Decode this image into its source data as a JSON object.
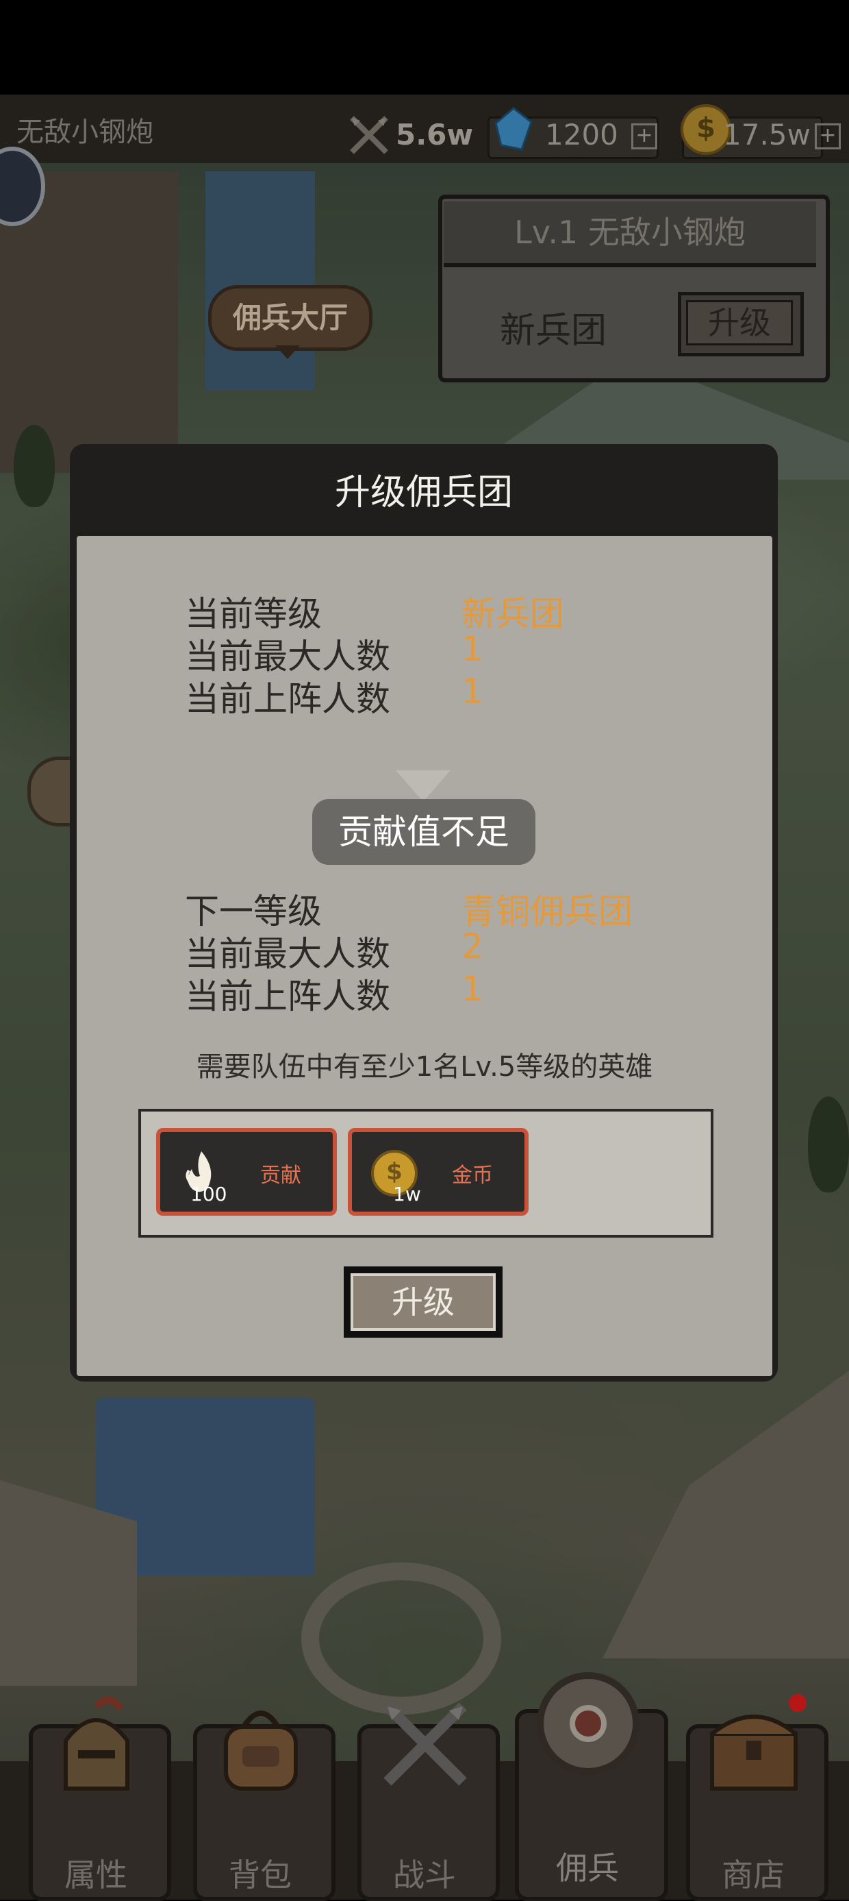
{
  "topbar": {
    "player_name": "无敌小钢炮",
    "power": "5.6w",
    "gems": "1200",
    "gold": "17.5w",
    "plus": "+"
  },
  "map": {
    "hall_label": "佣兵大厅"
  },
  "info_panel": {
    "level_title": "Lv.1 无敌小钢炮",
    "rank": "新兵团",
    "upgrade_label": "升级"
  },
  "dialog": {
    "title": "升级佣兵团",
    "current": [
      {
        "label": "当前等级",
        "value": "新兵团"
      },
      {
        "label": "当前最大人数",
        "value": "1"
      },
      {
        "label": "当前上阵人数",
        "value": "1"
      }
    ],
    "toast": "贡献值不足",
    "next": [
      {
        "label": "下一等级",
        "value": "青铜佣兵团"
      },
      {
        "label": "当前最大人数",
        "value": "2"
      },
      {
        "label": "当前上阵人数",
        "value": "1"
      }
    ],
    "requirement": "需要队伍中有至少1名Lv.5等级的英雄",
    "costs": [
      {
        "name": "贡献",
        "amount": "100",
        "icon": "flame-icon"
      },
      {
        "name": "金币",
        "amount": "1w",
        "icon": "gold-coin-icon"
      }
    ],
    "upgrade_button": "升级"
  },
  "bottom_nav": [
    {
      "label": "属性",
      "icon": "knight-helmet-icon"
    },
    {
      "label": "背包",
      "icon": "backpack-icon"
    },
    {
      "label": "战斗",
      "icon": "crossed-swords-icon"
    },
    {
      "label": "佣兵",
      "icon": "target-icon"
    },
    {
      "label": "商店",
      "icon": "treasure-chest-icon"
    }
  ],
  "colors": {
    "accent_value": "#e39a3e",
    "cost_border": "#c9533a",
    "badge": "#e01b1b"
  }
}
